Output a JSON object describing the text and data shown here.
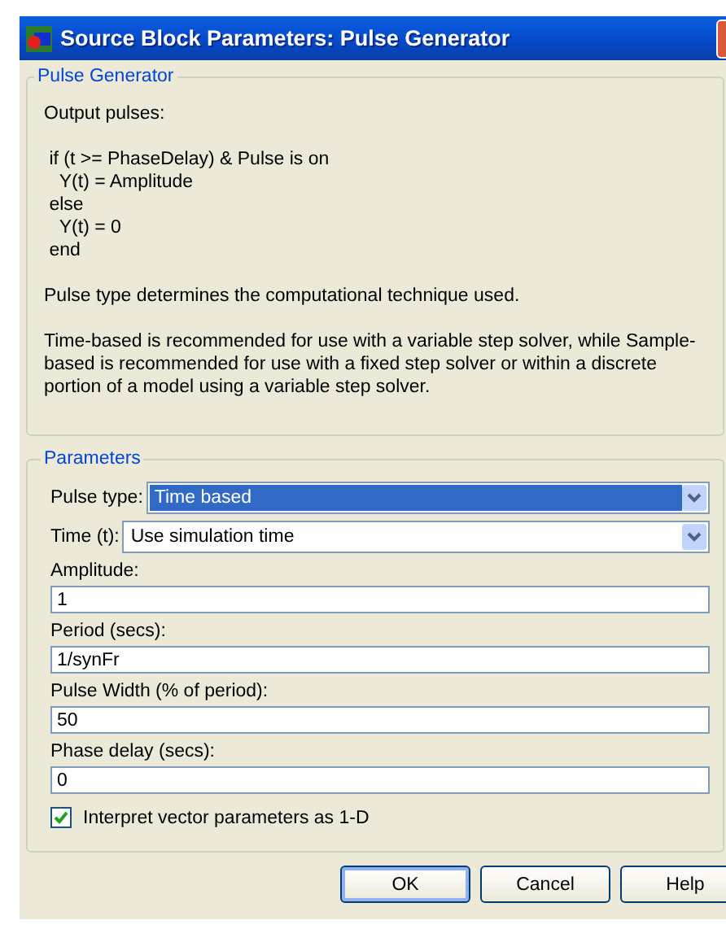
{
  "window": {
    "title": "Source Block Parameters: Pulse Generator"
  },
  "description": {
    "group_title": "Pulse Generator",
    "blocks": [
      {
        "kind": "text",
        "text": "Output pulses:"
      },
      {
        "kind": "code",
        "lines": [
          "if (t >= PhaseDelay) & Pulse is on",
          "  Y(t) = Amplitude",
          "else",
          "  Y(t) = 0",
          "end"
        ]
      },
      {
        "kind": "text",
        "text": "Pulse type determines the computational technique used."
      },
      {
        "kind": "text",
        "text": "Time-based is recommended for use with a variable step solver, while Sample-based is recommended for use with a fixed step solver or within a discrete portion of a model using a variable step solver."
      }
    ]
  },
  "parameters": {
    "group_title": "Parameters",
    "items": [
      {
        "kind": "dropdown",
        "label": "Pulse type:",
        "value": "Time based",
        "focused": true
      },
      {
        "kind": "dropdown",
        "label": "Time (t):",
        "value": "Use simulation time",
        "focused": false
      },
      {
        "kind": "field",
        "label": "Amplitude:",
        "value": "1"
      },
      {
        "kind": "field",
        "label": "Period (secs):",
        "value": "1/synFr"
      },
      {
        "kind": "field",
        "label": "Pulse Width (% of period):",
        "value": "50"
      },
      {
        "kind": "field",
        "label": "Phase delay (secs):",
        "value": "0"
      },
      {
        "kind": "checkbox",
        "label": "Interpret vector parameters as 1-D",
        "checked": true
      }
    ]
  },
  "buttons": [
    {
      "label": "OK",
      "default": true
    },
    {
      "label": "Cancel",
      "default": false
    },
    {
      "label": "Help",
      "default": false
    }
  ]
}
